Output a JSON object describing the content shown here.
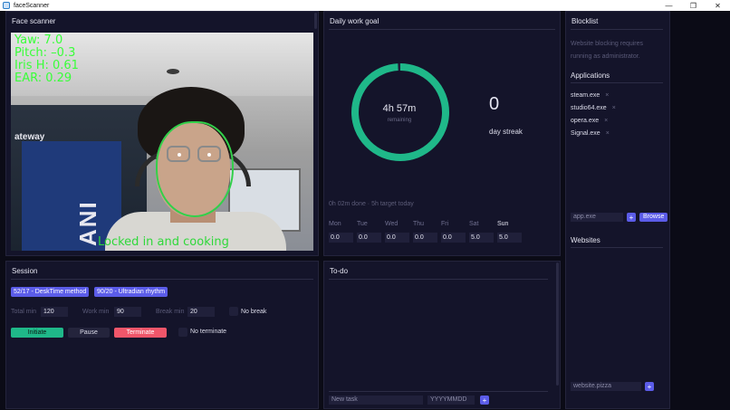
{
  "window": {
    "title": "faceScanner",
    "minimize": "—",
    "restore": "❐",
    "close": "✕"
  },
  "face_scanner": {
    "title": "Face scanner",
    "overlay": {
      "yaw": "Yaw: 7.0",
      "pitch": "Pitch: –0.3",
      "iris": "Iris  H: 0.61",
      "ear": "EAR: 0.29"
    },
    "status": "Locked in and cooking",
    "poster_text": "ANI",
    "poster_side_text": "ateway"
  },
  "daily_goal": {
    "title": "Daily work goal",
    "remaining_value": "4h 57m",
    "remaining_label": "remaining",
    "progress_done_fraction": 0.99,
    "streak_value": "0",
    "streak_label": "day streak",
    "note": "0h 02m done · 5h target today",
    "days": [
      {
        "label": "Mon",
        "value": "0.0",
        "today": false
      },
      {
        "label": "Tue",
        "value": "0.0",
        "today": false
      },
      {
        "label": "Wed",
        "value": "0.0",
        "today": false
      },
      {
        "label": "Thu",
        "value": "0.0",
        "today": false
      },
      {
        "label": "Fri",
        "value": "0.0",
        "today": false
      },
      {
        "label": "Sat",
        "value": "5.0",
        "today": false
      },
      {
        "label": "Sun",
        "value": "5.0",
        "today": true
      }
    ],
    "ring_color": "#1fb889",
    "ring_track": "#20203a"
  },
  "blocklist": {
    "title": "Blocklist",
    "admin_note_1": "Website blocking requires",
    "admin_note_2": "running as administrator.",
    "applications_title": "Applications",
    "applications": [
      "steam.exe",
      "studio64.exe",
      "opera.exe",
      "Signal.exe"
    ],
    "remove_glyph": "×",
    "app_placeholder": "app.exe",
    "add_label": "+",
    "browse_label": "Browse",
    "websites_title": "Websites",
    "website_placeholder": "website.pizza"
  },
  "session": {
    "title": "Session",
    "presets": [
      "52/17 - DeskTime method",
      "90/20 - Ultradian rhythm"
    ],
    "total_label": "Total min",
    "total_value": "120",
    "work_label": "Work min",
    "work_value": "90",
    "break_label": "Break min",
    "break_value": "20",
    "no_break_label": "No break",
    "initiate_label": "Initiate",
    "pause_label": "Pause",
    "terminate_label": "Terminate",
    "no_terminate_label": "No terminate",
    "accent": "#5b5ce8",
    "initiate_color": "#1fb889",
    "terminate_color": "#f0566a"
  },
  "todo": {
    "title": "To-do",
    "task_placeholder": "New task",
    "date_placeholder": "YYYYMMDD",
    "add_label": "+"
  }
}
